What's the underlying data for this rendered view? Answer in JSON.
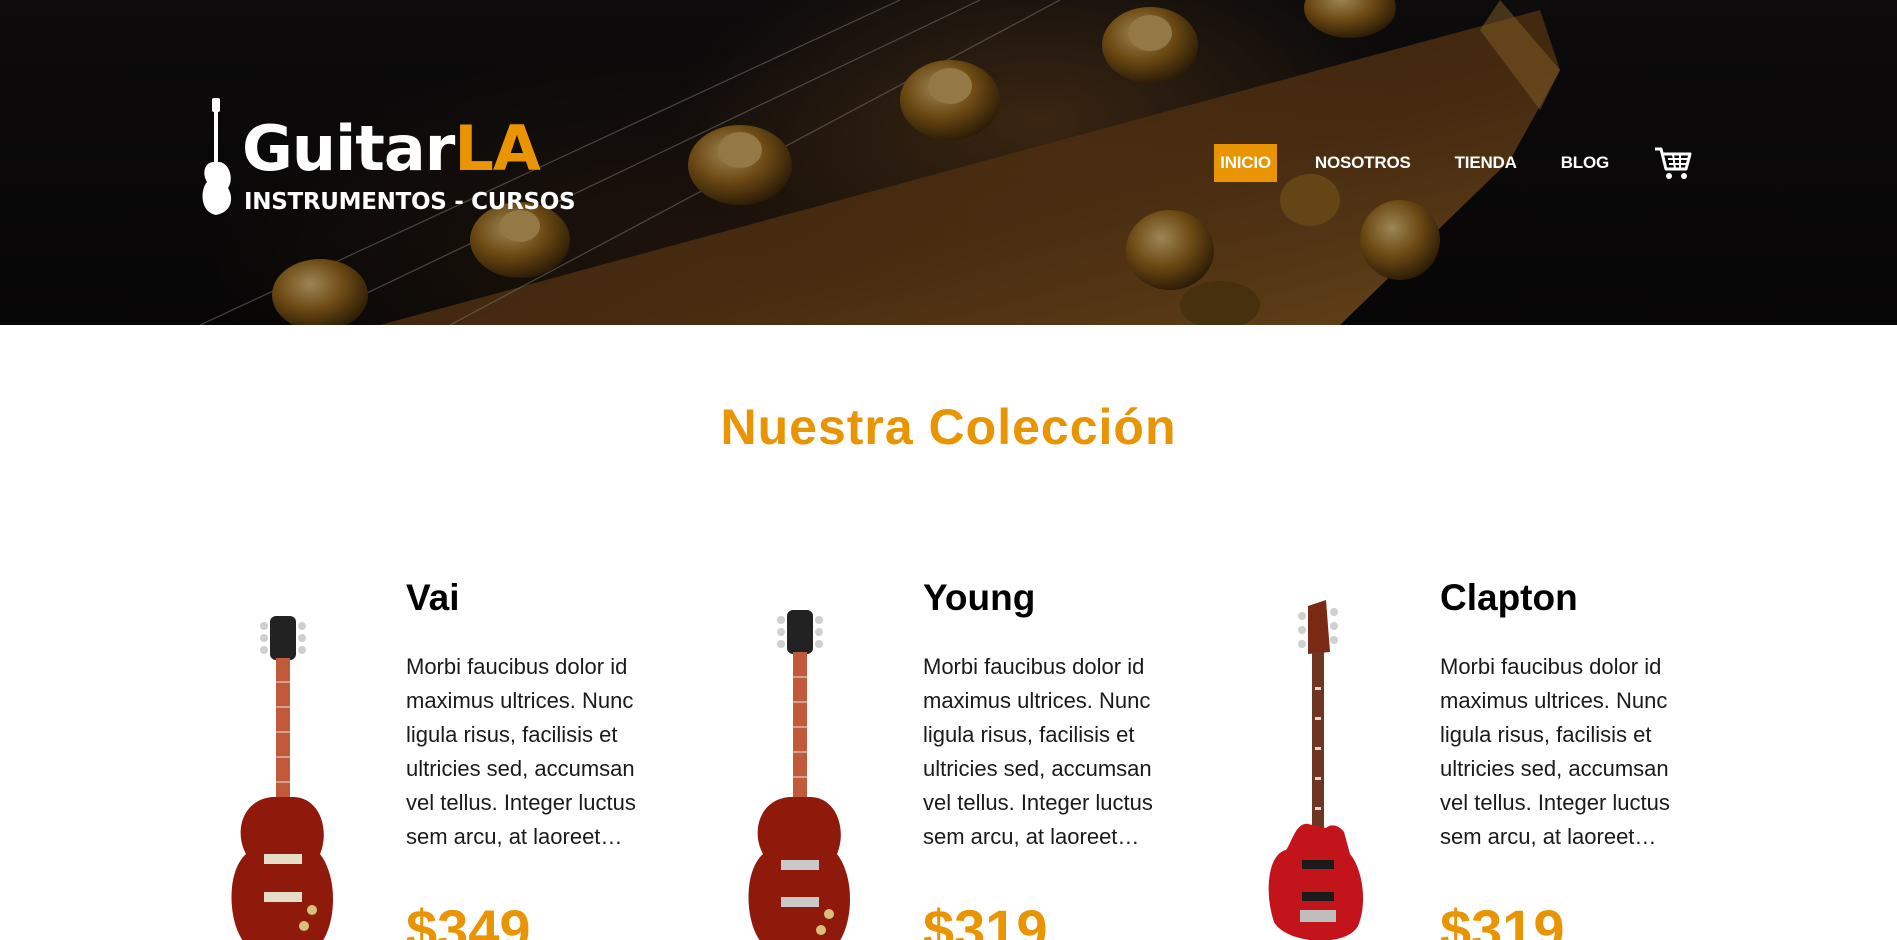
{
  "header": {
    "logo": {
      "brand_main": "Guitar",
      "brand_accent": "LA",
      "tagline": "INSTRUMENTOS - CURSOS"
    },
    "nav": [
      {
        "label": "INICIO",
        "active": true
      },
      {
        "label": "NOSOTROS",
        "active": false
      },
      {
        "label": "TIENDA",
        "active": false
      },
      {
        "label": "BLOG",
        "active": false
      }
    ],
    "cart_icon": "shopping-cart-icon"
  },
  "main": {
    "heading": "Nuestra Colección",
    "products": [
      {
        "name": "Vai",
        "description": "Morbi faucibus dolor id maximus ultrices. Nunc ligula risus, facilisis et ultricies sed, accumsan vel tellus. Integer luctus sem arcu, at laoreet…",
        "price": "$349",
        "body_color": "#8f1a0c"
      },
      {
        "name": "Young",
        "description": "Morbi faucibus dolor id maximus ultrices. Nunc ligula risus, facilisis et ultricies sed, accumsan vel tellus. Integer luctus sem arcu, at laoreet…",
        "price": "$319",
        "body_color": "#8f1a0c"
      },
      {
        "name": "Clapton",
        "description": "Morbi faucibus dolor id maximus ultrices. Nunc ligula risus, facilisis et ultricies sed, accumsan vel tellus. Integer luctus sem arcu, at laoreet…",
        "price": "$319",
        "body_color": "#c3141c"
      }
    ]
  },
  "colors": {
    "accent": "#e99402",
    "header_bg": "#0c0a0a"
  }
}
